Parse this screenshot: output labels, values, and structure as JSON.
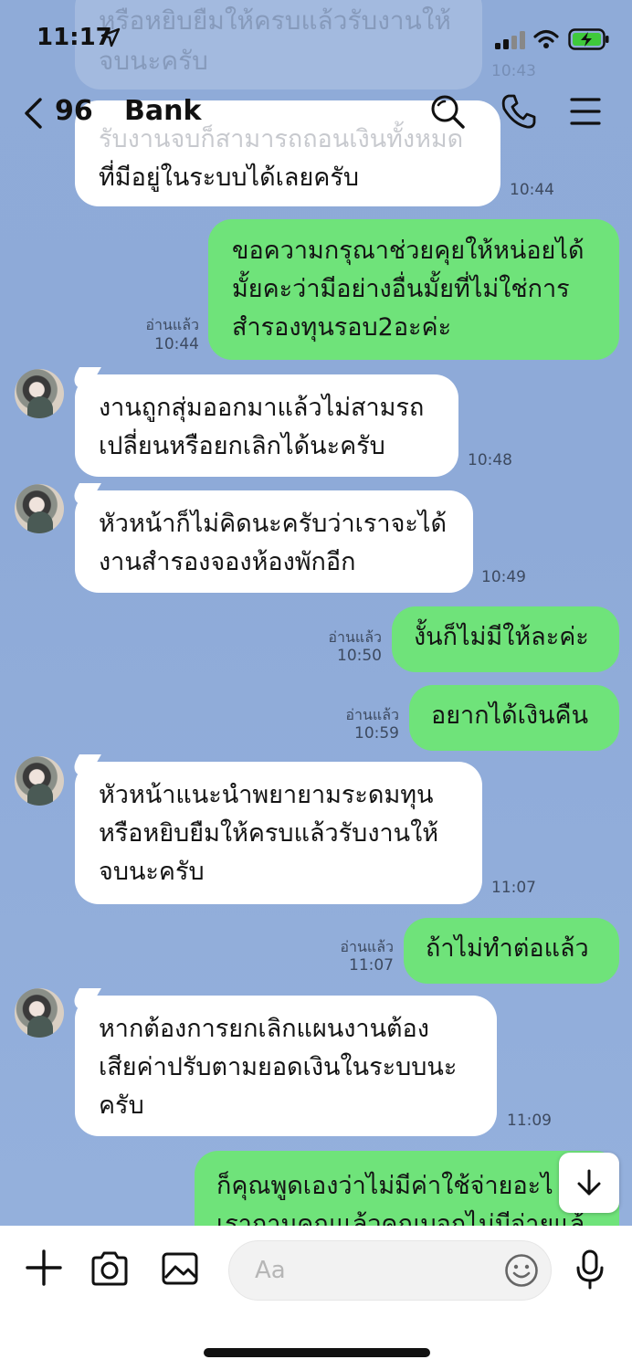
{
  "status": {
    "time": "11:17"
  },
  "header": {
    "unread_count": "96",
    "title": "Bank"
  },
  "ghost": {
    "line1": "หรือหยิบยืมให้ครบแล้วรับงานให้",
    "line2": "จบนะครับ",
    "time": "10:43",
    "line3": "รับงานจบก็สามารถถอนเงินทั้งหมด"
  },
  "messages": [
    {
      "text": "ที่มีอยู่ในระบบได้เลยครับ",
      "time": "10:44"
    },
    {
      "text": "ขอความกรุณาช่วยคุยให้หน่อยได้\nมั้ยคะว่ามีอย่างอื่นมั้ยที่ไม่ใช่การ\nสำรองทุนรอบ2อะค่ะ",
      "read": "อ่านแล้ว",
      "time": "10:44"
    },
    {
      "text": "งานถูกสุ่มออกมาแล้วไม่สามรถ\nเปลี่ยนหรือยกเลิกได้นะครับ",
      "time": "10:48"
    },
    {
      "text": "หัวหน้าก็ไม่คิดนะครับว่าเราจะได้\nงานสำรองจองห้องพักอีก",
      "time": "10:49"
    },
    {
      "text": "งั้นก็ไม่มีให้ละค่ะ",
      "read": "อ่านแล้ว",
      "time": "10:50"
    },
    {
      "text": "อยากได้เงินคืน",
      "read": "อ่านแล้ว",
      "time": "10:59"
    },
    {
      "text": "หัวหน้าแนะนำพยายามระดมทุน\nหรือหยิบยืมให้ครบแล้วรับงานให้\nจบนะครับ",
      "time": "11:07"
    },
    {
      "text": "ถ้าไม่ทำต่อแล้ว",
      "read": "อ่านแล้ว",
      "time": "11:07"
    },
    {
      "text": "หากต้องการยกเลิกแผนงานต้อง\nเสียค่าปรับตามยอดเงินในระบบนะ\nครับ",
      "time": "11:09"
    },
    {
      "text": "ก็คุณพูดเองว่าไม่มีค่าใช้จ่ายอะไ\nเราถามคุณแล้วคุณบอกไม่มีจ่ายแล้"
    }
  ],
  "composer": {
    "placeholder": "Aa"
  }
}
